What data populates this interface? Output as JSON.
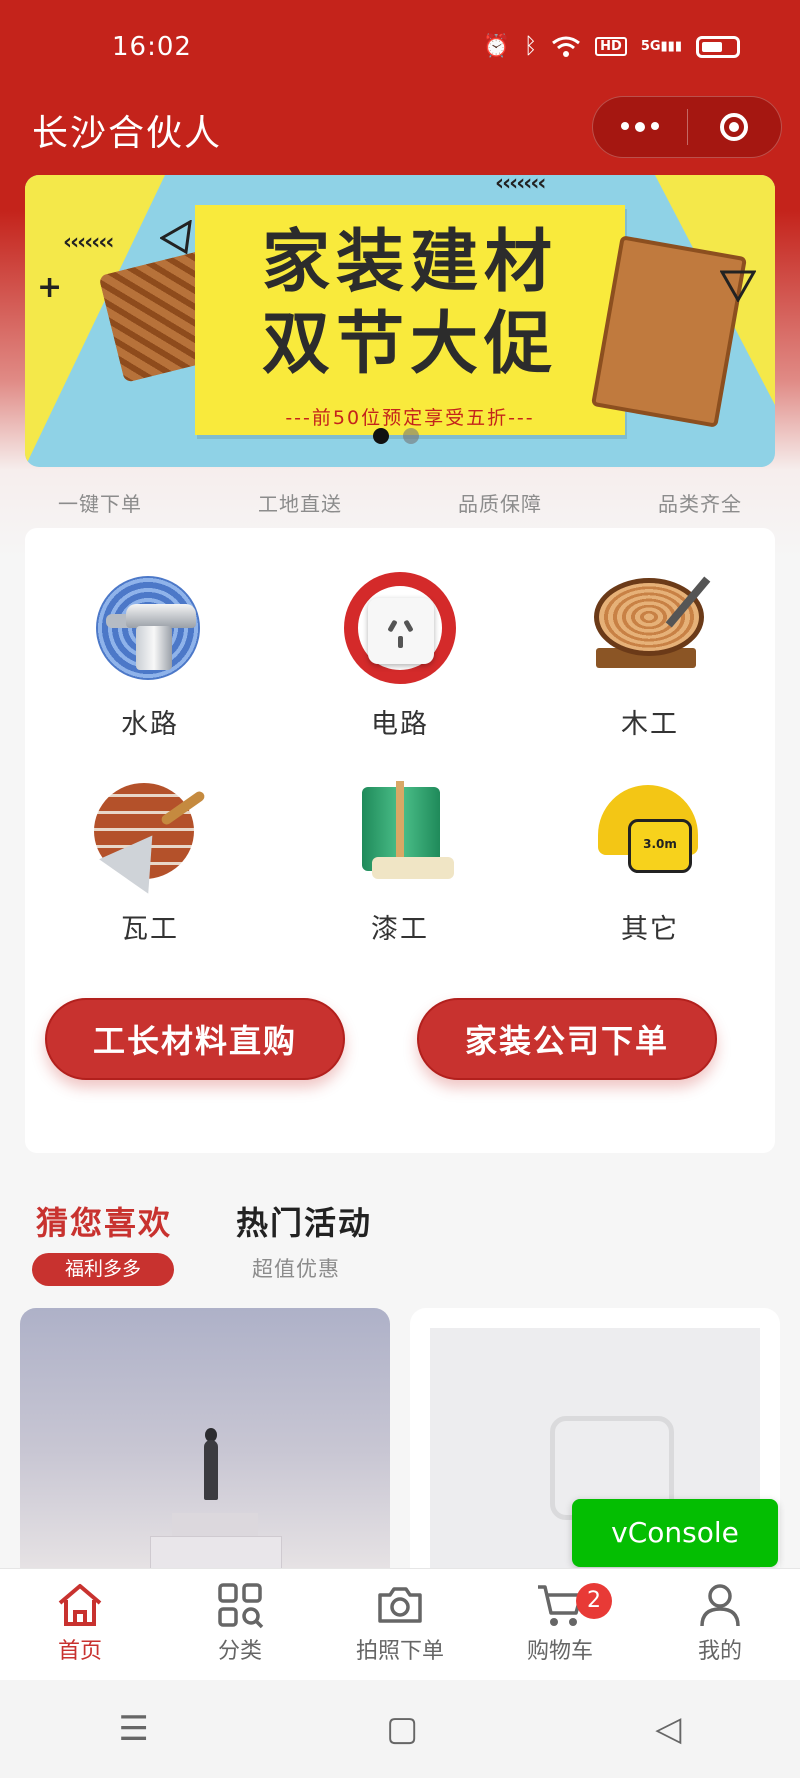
{
  "status_bar": {
    "time": "16:02",
    "network": "5G",
    "hd": "HD"
  },
  "title_bar": {
    "title": "长沙合伙人"
  },
  "banner": {
    "line1": "家装建材",
    "line2": "双节大促",
    "subtitle": "---前50位预定享受五折---",
    "slide_count": 2,
    "active_slide": 1
  },
  "features": [
    "一键下单",
    "工地直送",
    "品质保障",
    "品类齐全"
  ],
  "categories": [
    {
      "label": "水路",
      "icon": "faucet-icon"
    },
    {
      "label": "电路",
      "icon": "socket-icon"
    },
    {
      "label": "木工",
      "icon": "wood-icon"
    },
    {
      "label": "瓦工",
      "icon": "trowel-icon"
    },
    {
      "label": "漆工",
      "icon": "paint-icon"
    },
    {
      "label": "其它",
      "icon": "helmet-icon"
    }
  ],
  "buttons": {
    "direct_buy": "工长材料直购",
    "company_order": "家装公司下单"
  },
  "tabs": [
    {
      "label": "猜您喜欢",
      "sub": "福利多多",
      "active": true
    },
    {
      "label": "热门活动",
      "sub": "超值优惠",
      "active": false
    }
  ],
  "vconsole": {
    "label": "vConsole"
  },
  "tabbar": [
    {
      "label": "首页",
      "icon": "home-icon",
      "active": true
    },
    {
      "label": "分类",
      "icon": "category-icon",
      "active": false
    },
    {
      "label": "拍照下单",
      "icon": "camera-icon",
      "active": false
    },
    {
      "label": "购物车",
      "icon": "cart-icon",
      "active": false,
      "badge": "2"
    },
    {
      "label": "我的",
      "icon": "user-icon",
      "active": false
    }
  ],
  "colors": {
    "brand": "#c4231b",
    "accent": "#c8322f",
    "vconsole": "#04be02"
  }
}
